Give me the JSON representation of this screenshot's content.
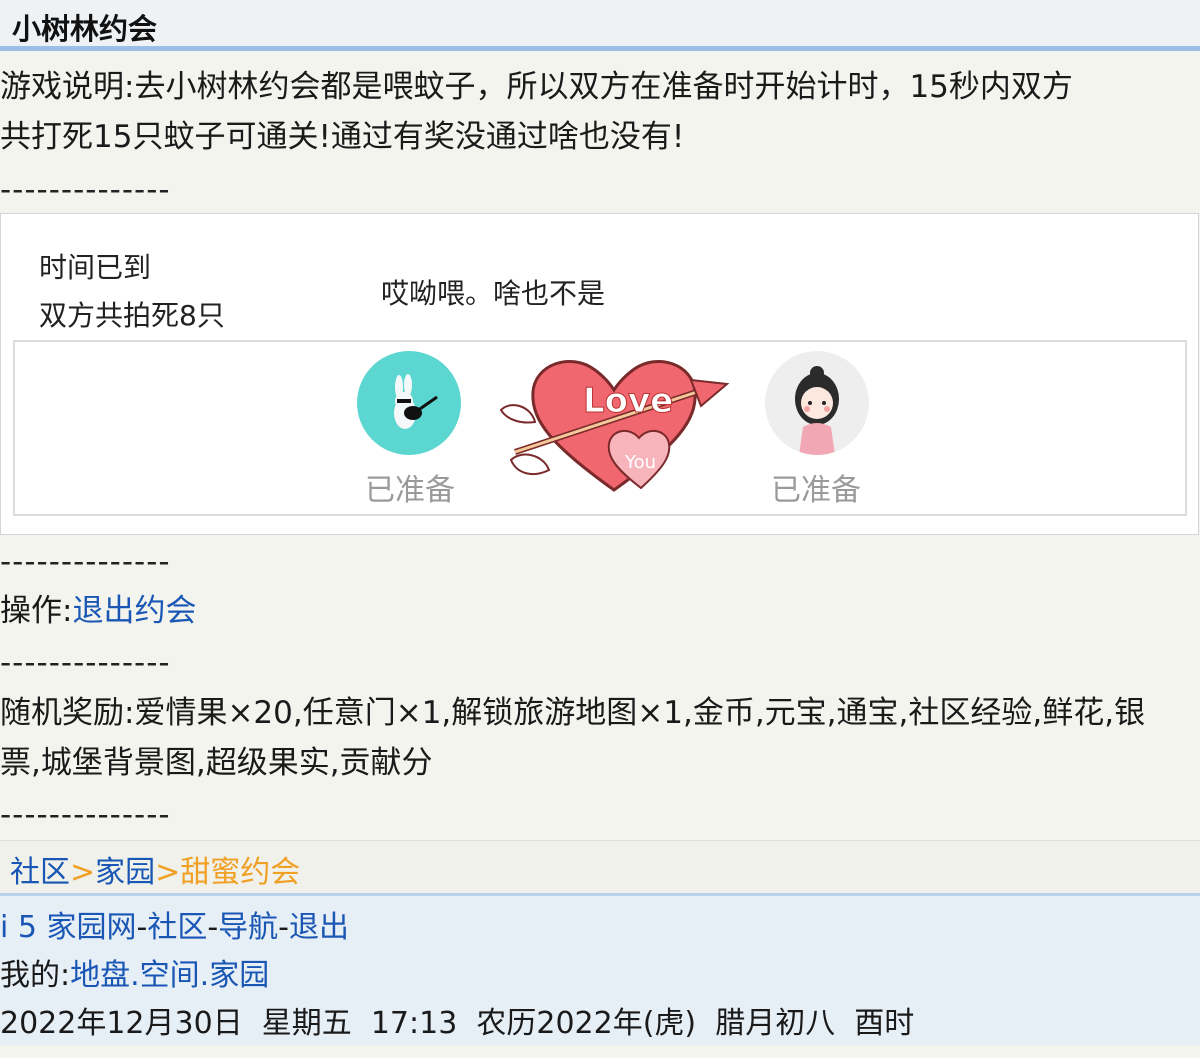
{
  "header": {
    "title": "小树林约会"
  },
  "intro": {
    "line1": "游戏说明:去小树林约会都是喂蚊子，所以双方在准备时开始计时，15秒内双方",
    "line2": "共打死15只蚊子可通关!通过有奖没通过啥也没有!"
  },
  "divider": "--------------",
  "game": {
    "status_line1": "时间已到",
    "status_line2": "双方共拍死8只",
    "result_message": "哎呦喂。啥也不是",
    "left_player_status": "已准备",
    "right_player_status": "已准备",
    "heart_text1": "Love",
    "heart_text2": "You"
  },
  "operation": {
    "label": "操作:",
    "exit_link": "退出约会"
  },
  "rewards": {
    "line1": "随机奖励:爱情果×20,任意门×1,解锁旅游地图×1,金币,元宝,通宝,社区经验,鲜花,银",
    "line2": "票,城堡背景图,超级果实,贡献分"
  },
  "breadcrumb": {
    "item1": "社区",
    "sep": ">",
    "item2": "家园",
    "current": "甜蜜约会"
  },
  "footer": {
    "site": "i 5 家园网",
    "dash": "-",
    "community": "社区",
    "nav": "导航",
    "logout": "退出",
    "mine_label": "我的:",
    "territory": "地盘",
    "dot": ".",
    "space": "空间",
    "home": "家园",
    "datetime": "2022年12月30日  星期五  17:13  农历2022年(虎)  腊月初八  酉时"
  },
  "colors": {
    "link": "#1a57b5",
    "current_crumb": "#f0a024",
    "header_border": "#9dbfe6"
  }
}
